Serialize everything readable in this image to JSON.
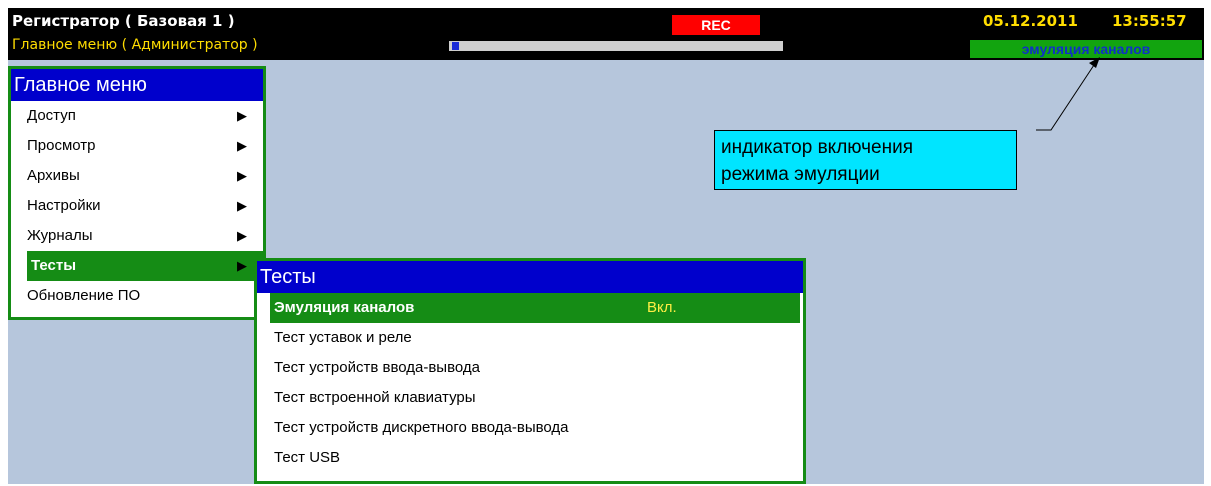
{
  "header": {
    "title": "Регистратор ( Базовая 1 )",
    "subtitle": "Главное меню ( Администратор )",
    "rec_label": "REC",
    "date": "05.12.2011",
    "time": "13:55:57",
    "emulation_indicator": "эмуляция каналов",
    "progress_fraction": 0.02
  },
  "main_menu": {
    "title": "Главное меню",
    "items": [
      {
        "label": "Доступ"
      },
      {
        "label": "Просмотр"
      },
      {
        "label": "Архивы"
      },
      {
        "label": "Настройки"
      },
      {
        "label": "Журналы"
      },
      {
        "label": "Тесты"
      },
      {
        "label": "Обновление ПО"
      }
    ],
    "selected_index": 5
  },
  "tests_menu": {
    "title": "Тесты",
    "items": [
      {
        "label": "Эмуляция каналов",
        "value": "Вкл."
      },
      {
        "label": "Тест уставок и реле"
      },
      {
        "label": "Тест устройств ввода-вывода"
      },
      {
        "label": "Тест встроенной клавиатуры"
      },
      {
        "label": "Тест устройств дискретного ввода-вывода"
      },
      {
        "label": "Тест USB"
      }
    ],
    "selected_index": 0
  },
  "callout": {
    "line1": "индикатор включения",
    "line2": "режима эмуляции"
  },
  "colors": {
    "background": "#b6c6dc",
    "header_bar": "#000000",
    "menu_header": "#0000cc",
    "selection": "#158c15",
    "rec": "#ff0000",
    "indicator_bg": "#12a40f",
    "indicator_text": "#1030c8",
    "callout_bg": "#00e5ff",
    "date_time": "#ffdd00"
  },
  "icons": {
    "submenu_arrow": "triangle-right-icon"
  }
}
